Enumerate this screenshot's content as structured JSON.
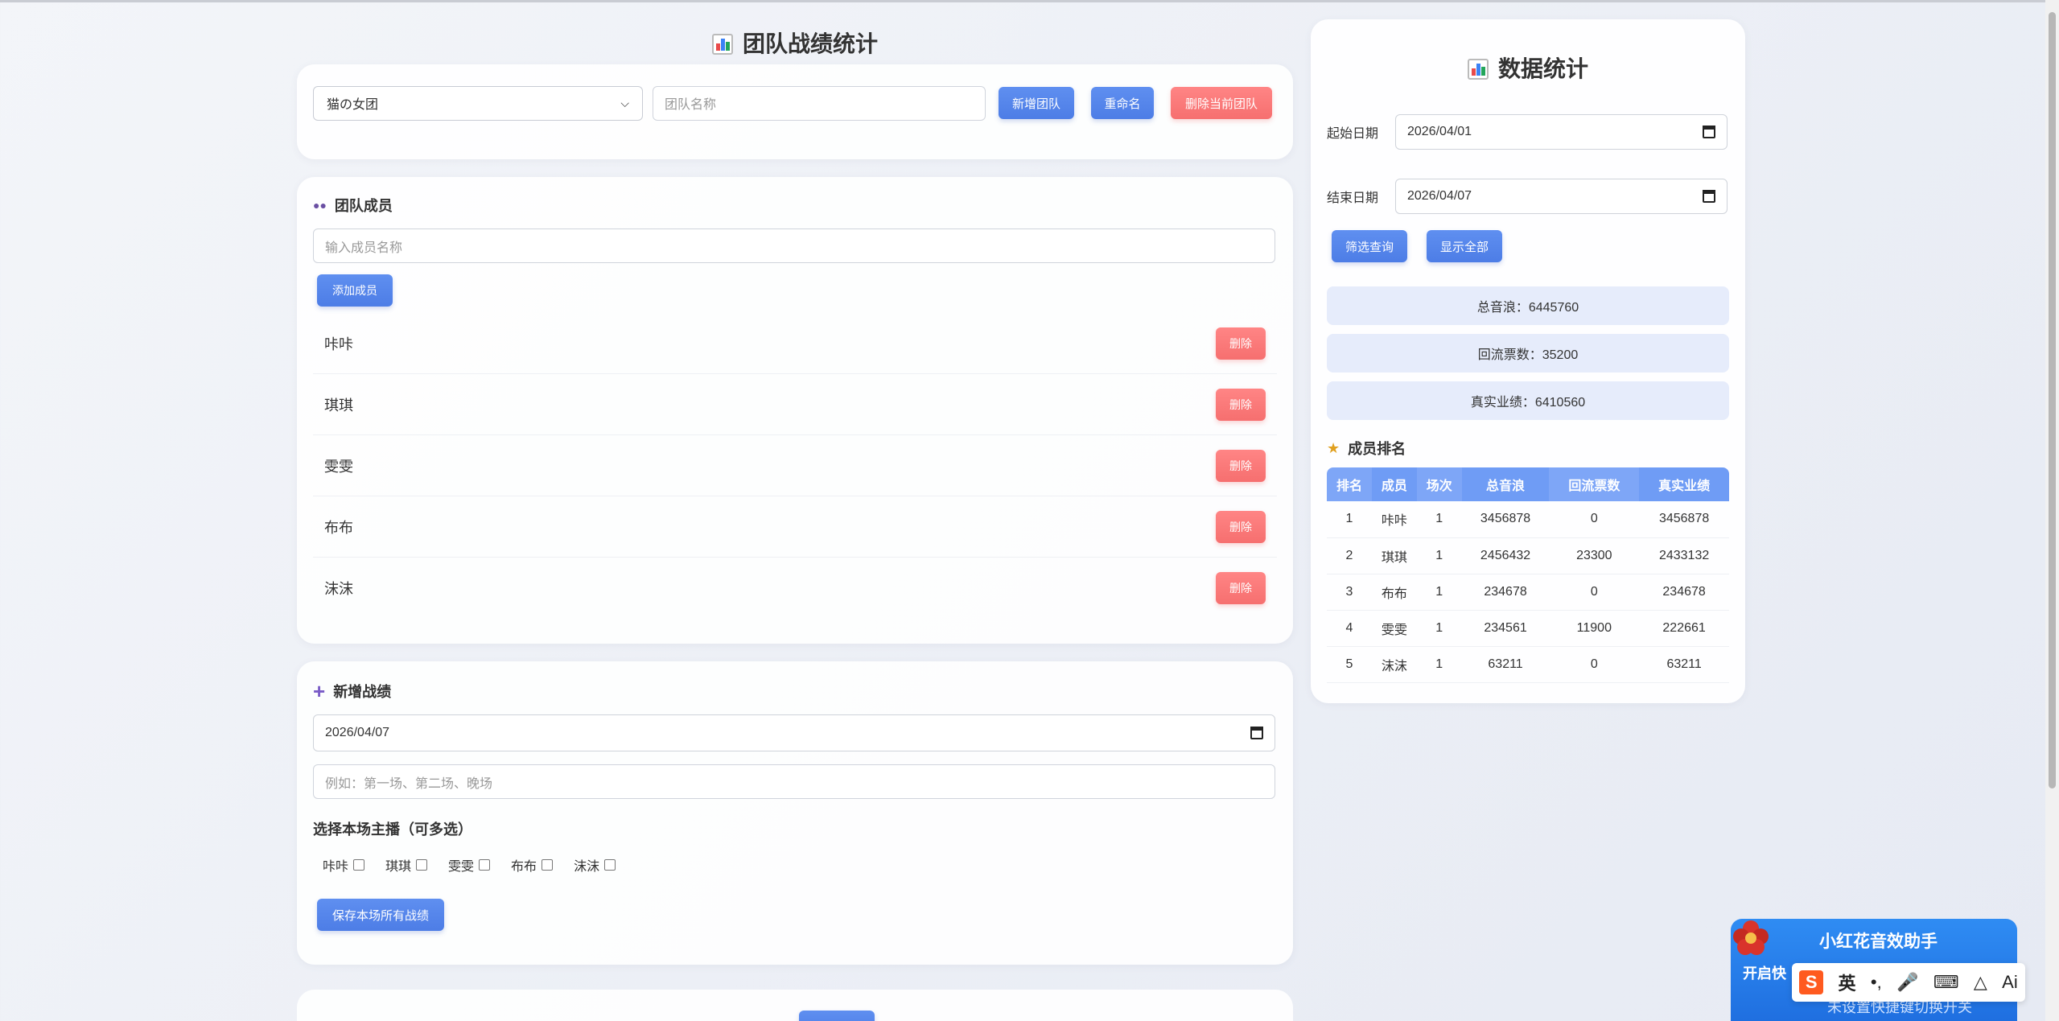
{
  "header": {
    "title": "团队战绩统计"
  },
  "team": {
    "selected": "猫の女团",
    "name_placeholder": "团队名称",
    "add_label": "新增团队",
    "rename_label": "重命名",
    "delete_label": "删除当前团队"
  },
  "members": {
    "title": "团队成员",
    "input_placeholder": "输入成员名称",
    "add_label": "添加成员",
    "delete_label": "删除",
    "list": [
      "咔咔",
      "琪琪",
      "雯雯",
      "布布",
      "沫沫"
    ]
  },
  "record": {
    "title": "新增战绩",
    "date": "2026/04/07",
    "session_placeholder": "例如：第一场、第二场、晚场",
    "hosts_title": "选择本场主播（可多选）",
    "hosts": [
      "咔咔",
      "琪琪",
      "雯雯",
      "布布",
      "沫沫"
    ],
    "save_label": "保存本场所有战绩"
  },
  "stats": {
    "title": "数据统计",
    "start_label": "起始日期",
    "start_date": "2026/04/01",
    "end_label": "结束日期",
    "end_date": "2026/04/07",
    "filter_label": "筛选查询",
    "show_all_label": "显示全部",
    "total_wave": "总音浪：6445760",
    "refund_tickets": "回流票数：35200",
    "real_perf": "真实业绩：6410560",
    "ranking_title": "成员排名",
    "columns": [
      "排名",
      "成员",
      "场次",
      "总音浪",
      "回流票数",
      "真实业绩"
    ],
    "rows": [
      [
        "1",
        "咔咔",
        "1",
        "3456878",
        "0",
        "3456878"
      ],
      [
        "2",
        "琪琪",
        "1",
        "2456432",
        "23300",
        "2433132"
      ],
      [
        "3",
        "布布",
        "1",
        "234678",
        "0",
        "234678"
      ],
      [
        "4",
        "雯雯",
        "1",
        "234561",
        "11900",
        "222661"
      ],
      [
        "5",
        "沫沫",
        "1",
        "63211",
        "0",
        "63211"
      ]
    ]
  },
  "widget": {
    "title": "小红花音效助手",
    "open_label": "开启快",
    "hint": "未设置快捷键切换开关"
  },
  "ime": {
    "lang": "英",
    "ai": "Ai"
  }
}
